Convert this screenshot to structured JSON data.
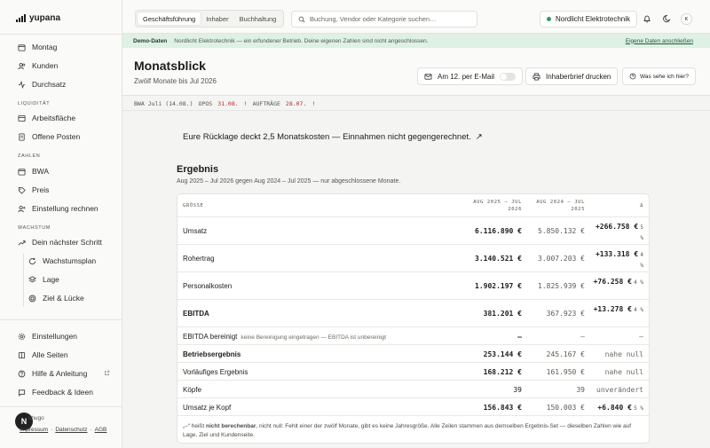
{
  "brand": {
    "name": "yupana"
  },
  "sidebar": {
    "top_items": [
      {
        "label": "Montag",
        "icon": "calendar-icon"
      },
      {
        "label": "Kunden",
        "icon": "users-icon"
      },
      {
        "label": "Durchsatz",
        "icon": "activity-icon"
      }
    ],
    "sections": [
      {
        "label": "LIQUIDITÄT",
        "items": [
          {
            "label": "Arbeitsfläche",
            "icon": "layout-icon"
          },
          {
            "label": "Offene Posten",
            "icon": "receipt-icon"
          }
        ]
      },
      {
        "label": "ZAHLEN",
        "items": [
          {
            "label": "BWA",
            "icon": "calendar-icon"
          },
          {
            "label": "Preis",
            "icon": "tag-icon"
          },
          {
            "label": "Einstellung rechnen",
            "icon": "user-plus-icon"
          }
        ]
      },
      {
        "label": "WACHSTUM",
        "items": [
          {
            "label": "Dein nächster Schritt",
            "icon": "trending-up-icon"
          },
          {
            "label": "Wachstumsplan",
            "icon": "refresh-icon"
          },
          {
            "label": "Lage",
            "icon": "layers-icon"
          },
          {
            "label": "Ziel & Lücke",
            "icon": "target-icon"
          }
        ]
      }
    ],
    "bottom_items": [
      {
        "label": "Einstellungen",
        "icon": "gear-icon"
      },
      {
        "label": "Alle Seiten",
        "icon": "grid-icon"
      },
      {
        "label": "Hilfe & Anleitung",
        "icon": "help-icon"
      },
      {
        "label": "Feedback & Ideen",
        "icon": "message-icon"
      }
    ],
    "user": {
      "initial": "N",
      "name": "chugo"
    },
    "footer": {
      "imprint": "Impressum",
      "sep": "·",
      "privacy": "Datenschutz",
      "terms": "AGB"
    }
  },
  "topbar": {
    "tabs": [
      "Geschäftsführung",
      "Inhaber",
      "Buchhaltung"
    ],
    "active_tab": 0,
    "search_placeholder": "Buchung, Vendor oder Kategorie suchen…",
    "company": "Nordlicht Elektrotechnik",
    "user_initial": "K"
  },
  "banner": {
    "label": "Demo-Daten",
    "text": "Nordlicht Elektrotechnik — ein erfundener Betrieb. Deine eigenen Zahlen sind nicht angeschlossen.",
    "link": "Eigene Daten anschließen"
  },
  "page": {
    "title": "Monatsblick",
    "subtitle": "Zwölf Monate bis Jul 2026",
    "email_button": "Am 12. per E-Mail",
    "print_button": "Inhaberbrief drucken",
    "help_button": "Was sehe ich hier?"
  },
  "status": {
    "bwa": "BWA Juli (14.08.)",
    "opos_label": "OPOS",
    "opos_date": "31.08.",
    "opos_mark": "!",
    "auftraege_label": "AUFTRÄGE",
    "auftraege_date": "28.07.",
    "auftraege_mark": "!"
  },
  "headline": {
    "text": "Eure Rücklage deckt 2,5 Monatskosten — Einnahmen nicht gegengerechnet.",
    "arrow": "↗"
  },
  "ergebnis": {
    "title": "Ergebnis",
    "subtitle": "Aug 2025 – Jul 2026 gegen Aug 2024 – Jul 2025 — nur abgeschlossene Monate.",
    "headers": {
      "label": "GRÖSSE",
      "current": "AUG 2025 – JUL 2026",
      "previous": "AUG 2024 – JUL 2025",
      "delta": "Δ"
    },
    "rows": [
      {
        "name": "Umsatz",
        "current": "6.116.890 €",
        "previous": "5.850.132 €",
        "delta": "+266.758 €",
        "pct": "5 %"
      },
      {
        "name": "Rohertrag",
        "current": "3.140.521 €",
        "previous": "3.007.203 €",
        "delta": "+133.318 €",
        "pct": "4 %"
      },
      {
        "name": "Personalkosten",
        "current": "1.902.197 €",
        "previous": "1.825.939 €",
        "delta": "+76.258 €",
        "pct": "4 %"
      },
      {
        "name": "EBITDA",
        "current": "381.201 €",
        "previous": "367.923 €",
        "delta": "+13.278 €",
        "pct": "4 %"
      }
    ],
    "rows2": [
      {
        "name": "EBITDA bereinigt",
        "note": "keine Bereinigung eingetragen — EBITDA ist unbereinigt",
        "current": "–",
        "previous": "–",
        "delta": "–"
      },
      {
        "name": "Betriebsergebnis",
        "current": "253.144 €",
        "previous": "245.167 €",
        "delta": "nahe null"
      },
      {
        "name": "Vorläufiges Ergebnis",
        "current": "168.212 €",
        "previous": "161.950 €",
        "delta": "nahe null"
      },
      {
        "name": "Köpfe",
        "current": "39",
        "previous": "39",
        "delta": "unverändert"
      },
      {
        "name": "Umsatz je Kopf",
        "current": "156.843 €",
        "previous": "150.003 €",
        "delta": "+6.840 €",
        "pct": "5 %"
      }
    ],
    "footnote_a": "„–“ heißt",
    "footnote_b": "nicht berechenbar",
    "footnote_c": ", nicht null: Fehlt einer der zwölf Monate, gibt es keine Jahresgröße. Alle Zeilen stammen aus demselben Ergebnis-Set — dieselben Zahlen wie auf Lage, Ziel und Kundenseite."
  }
}
